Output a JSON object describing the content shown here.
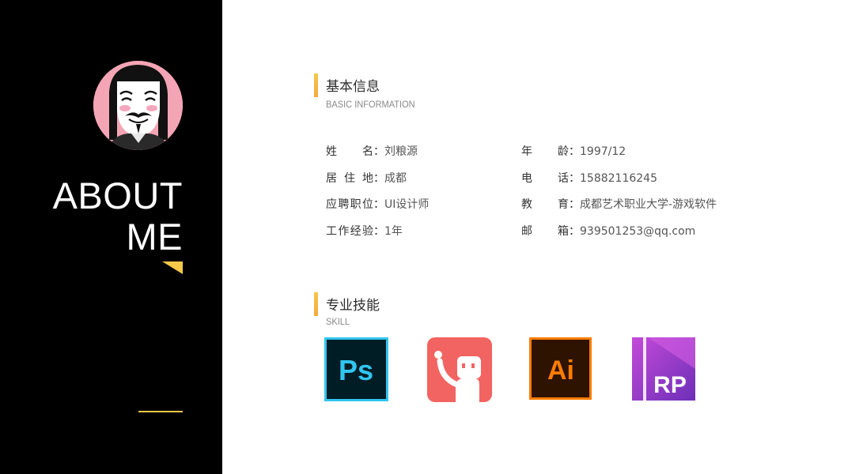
{
  "sidebar": {
    "heading_line1": "ABOUT",
    "heading_line2": "ME"
  },
  "basic": {
    "title": "基本信息",
    "subtitle": "BASIC INFORMATION",
    "left": [
      {
        "label": "姓名",
        "value": "刘粮源"
      },
      {
        "label": "居住地",
        "value": "成都"
      },
      {
        "label": "应聘职位",
        "value": "UI设计师"
      },
      {
        "label": "工作经验",
        "value": "1年"
      }
    ],
    "right": [
      {
        "label": "年龄",
        "value": "1997/12"
      },
      {
        "label": "电话",
        "value": "15882116245"
      },
      {
        "label": "教育",
        "value": "成都艺术职业大学-游戏软件"
      },
      {
        "label": "邮箱",
        "value": "939501253@qq.com"
      }
    ]
  },
  "skills": {
    "title": "专业技能",
    "subtitle": "SKILL",
    "items": [
      {
        "name": "photoshop-icon",
        "text": "Ps",
        "bg": "#001d26",
        "fg": "#31c5f0"
      },
      {
        "name": "robot-app-icon",
        "text": "",
        "bg": "#f26461",
        "fg": "#ffffff"
      },
      {
        "name": "illustrator-icon",
        "text": "Ai",
        "bg": "#2e1300",
        "fg": "#ff7c00"
      },
      {
        "name": "axure-rp-icon",
        "text": "RP",
        "bg": "#8c3cc9",
        "fg": "#ffffff"
      }
    ]
  },
  "colors": {
    "accent": "#f5c74b",
    "sidebar_bg": "#000000"
  }
}
